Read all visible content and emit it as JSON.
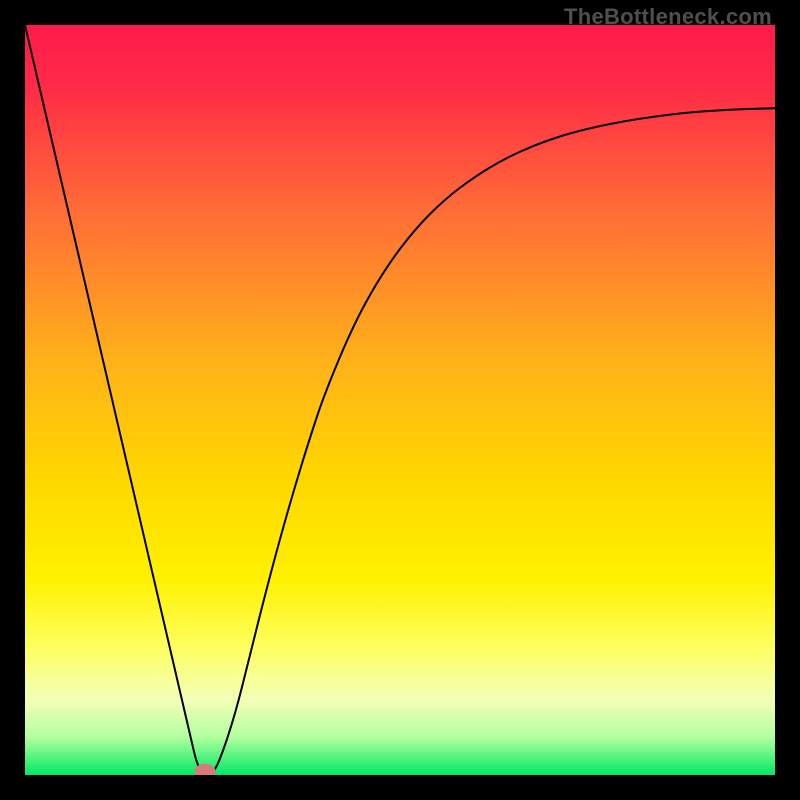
{
  "watermark": "TheBottleneck.com",
  "chart_data": {
    "type": "line",
    "title": "",
    "xlabel": "",
    "ylabel": "",
    "xlim": [
      0,
      100
    ],
    "ylim": [
      0,
      100
    ],
    "grid": false,
    "gradient_stops": [
      {
        "offset": 0,
        "color": "#ff1a4b"
      },
      {
        "offset": 0.08,
        "color": "#ff2a47"
      },
      {
        "offset": 0.25,
        "color": "#ff6d36"
      },
      {
        "offset": 0.45,
        "color": "#ffb219"
      },
      {
        "offset": 0.6,
        "color": "#ffd600"
      },
      {
        "offset": 0.74,
        "color": "#fff200"
      },
      {
        "offset": 0.83,
        "color": "#fdff60"
      },
      {
        "offset": 0.9,
        "color": "#f3ffb8"
      },
      {
        "offset": 0.95,
        "color": "#b0ff9e"
      },
      {
        "offset": 1.0,
        "color": "#00e865"
      }
    ],
    "series": [
      {
        "name": "curve",
        "color": "#000000",
        "width": 2,
        "x": [
          0,
          2,
          4,
          6,
          8,
          10,
          12,
          14,
          16,
          18,
          20,
          22,
          23,
          24,
          25,
          26,
          28,
          30,
          32,
          34,
          36,
          38,
          40,
          44,
          48,
          52,
          56,
          60,
          64,
          68,
          72,
          76,
          80,
          84,
          88,
          92,
          96,
          100
        ],
        "y": [
          100,
          91.4,
          82.8,
          74.2,
          65.6,
          57.0,
          48.4,
          39.8,
          31.2,
          22.6,
          14.0,
          5.4,
          1.1,
          0.0,
          0.2,
          2.0,
          8.0,
          16.0,
          24.0,
          31.5,
          38.5,
          45.0,
          51.0,
          60.5,
          67.5,
          72.8,
          76.8,
          79.8,
          82.2,
          84.0,
          85.4,
          86.4,
          87.2,
          87.8,
          88.3,
          88.6,
          88.8,
          88.9
        ]
      }
    ],
    "marker": {
      "x": 24.0,
      "y": 0.5,
      "rx": 1.4,
      "ry": 1.0,
      "color": "#d87a7a"
    }
  }
}
